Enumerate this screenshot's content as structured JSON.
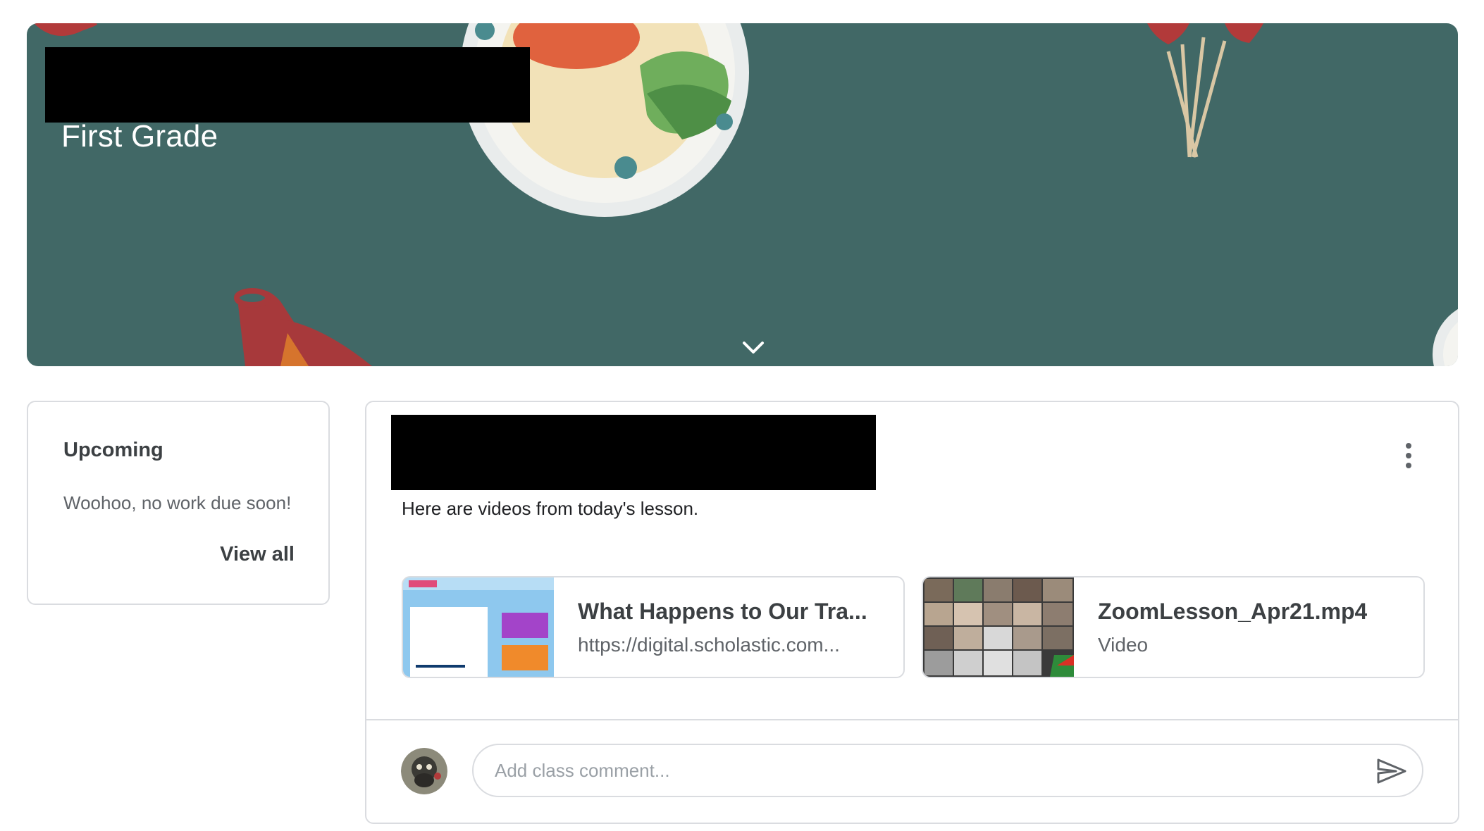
{
  "banner": {
    "class_title": "First Grade",
    "chevron_icon": "chevron-down-icon",
    "background_color": "#416866"
  },
  "upcoming": {
    "title": "Upcoming",
    "message": "Woohoo, no work due soon!",
    "view_all_label": "View all"
  },
  "post": {
    "menu_icon": "more-vert-icon",
    "text": "Here are videos from today's lesson.",
    "attachments": [
      {
        "title": "What Happens to Our Tra...",
        "subtitle": "https://digital.scholastic.com..."
      },
      {
        "title": "ZoomLesson_Apr21.mp4",
        "subtitle": "Video"
      }
    ],
    "comment": {
      "placeholder": "Add class comment...",
      "value": "",
      "send_icon": "send-icon"
    }
  },
  "colors": {
    "border": "#dadce0",
    "text_primary": "#202124",
    "text_secondary": "#5f6368"
  }
}
